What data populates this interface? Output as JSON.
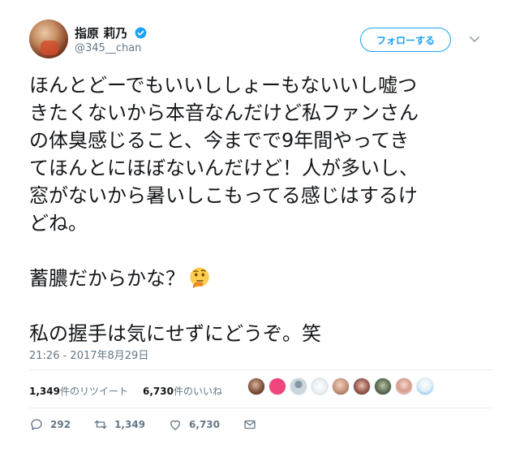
{
  "author": {
    "display_name": "指原 莉乃",
    "handle": "@345__chan"
  },
  "follow_label": "フォローする",
  "tweet": {
    "lines": [
      "ほんとどーでもいいししょーもないいし嘘つ",
      "きたくないから本音なんだけど私ファンさん",
      "の体臭感じること、今までで9年間やってき",
      "てほんとにほぼないんだけど！人が多いし、",
      "窓がないから暑いしこもってる感じはするけ",
      "どね。"
    ],
    "line2": "蓄膿だからかな？",
    "line3": "私の握手は気にせずにどうぞ。笑"
  },
  "timestamp": "21:26 - 2017年8月29日",
  "stats": {
    "retweets_count": "1,349",
    "retweets_label": "件のリツイート",
    "likes_count": "6,730",
    "likes_label": "件のいいね"
  },
  "actions": {
    "replies": "292",
    "retweets": "1,349",
    "likes": "6,730"
  },
  "colors": {
    "accent": "#1da1f2",
    "muted": "#657786",
    "text": "#14171a"
  }
}
